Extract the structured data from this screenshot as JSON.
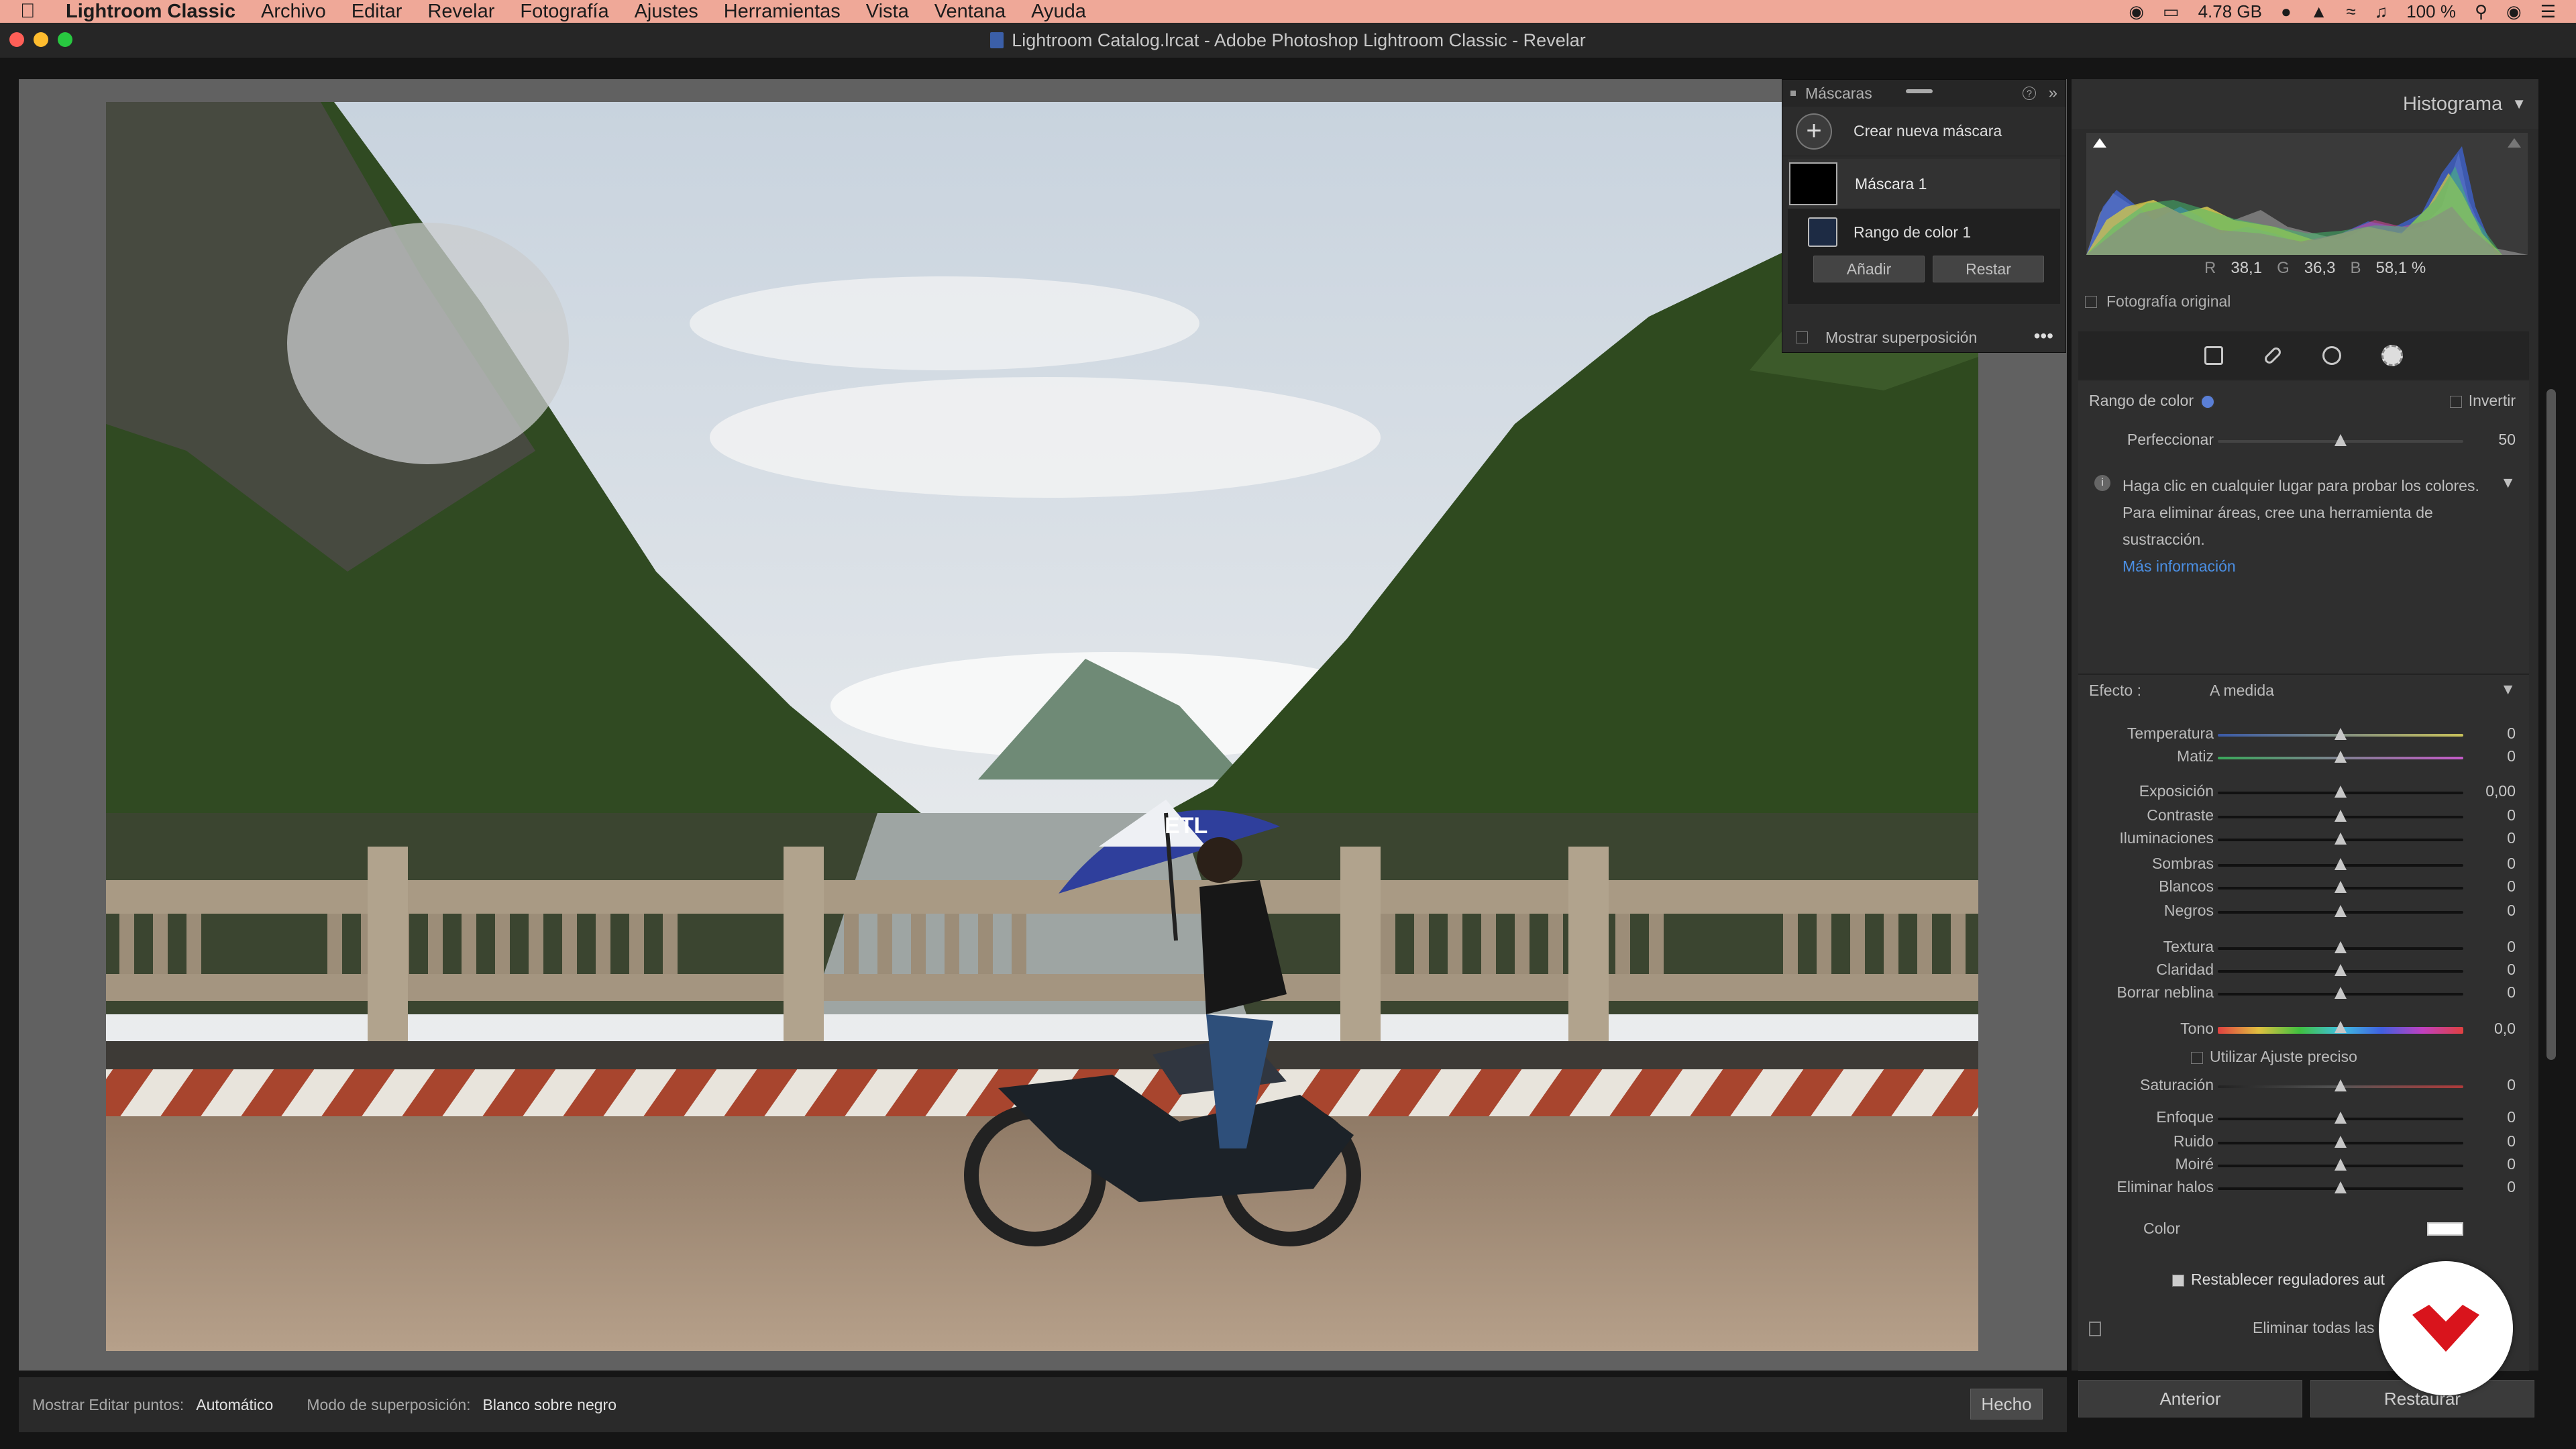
{
  "menubar": {
    "app_name": "Lightroom Classic",
    "items": [
      "Archivo",
      "Editar",
      "Revelar",
      "Fotografía",
      "Ajustes",
      "Herramientas",
      "Vista",
      "Ventana",
      "Ayuda"
    ],
    "memory": "4.78 GB",
    "battery": "100 %"
  },
  "window": {
    "title": "Lightroom Catalog.lrcat - Adobe Photoshop Lightroom Classic - Revelar"
  },
  "masks_panel": {
    "title": "Máscaras",
    "create_label": "Crear nueva máscara",
    "mask1_label": "Máscara 1",
    "component_label": "Rango de color 1",
    "add_label": "Añadir",
    "subtract_label": "Restar",
    "overlay_label": "Mostrar superposición"
  },
  "photo": {
    "umbrella_text": "ETL"
  },
  "bottom_toolbar": {
    "show_points_label": "Mostrar Editar puntos:",
    "show_points_value": "Automático",
    "overlay_mode_label": "Modo de superposición:",
    "overlay_mode_value": "Blanco sobre negro",
    "done_label": "Hecho"
  },
  "histogram": {
    "title": "Histograma",
    "r_label": "R",
    "r_value": "38,1",
    "g_label": "G",
    "g_value": "36,3",
    "b_label": "B",
    "b_value": "58,1 %",
    "original_label": "Fotografía original"
  },
  "mask_settings": {
    "color_range_label": "Rango de color",
    "invert_label": "Invertir",
    "refine_label": "Perfeccionar",
    "refine_value": "50",
    "refine_level": 0.5,
    "info_line1": "Haga clic en cualquier lugar para probar los colores.",
    "info_line2": "Para eliminar áreas, cree una herramienta de",
    "info_line3": "sustracción.",
    "more_info": "Más información"
  },
  "effect": {
    "label": "Efecto :",
    "preset": "A medida",
    "sliders": [
      {
        "label": "Temperatura",
        "value": "0"
      },
      {
        "label": "Matiz",
        "value": "0"
      },
      {
        "label": "Exposición",
        "value": "0,00"
      },
      {
        "label": "Contraste",
        "value": "0"
      },
      {
        "label": "Iluminaciones",
        "value": "0"
      },
      {
        "label": "Sombras",
        "value": "0"
      },
      {
        "label": "Blancos",
        "value": "0"
      },
      {
        "label": "Negros",
        "value": "0"
      },
      {
        "label": "Textura",
        "value": "0"
      },
      {
        "label": "Claridad",
        "value": "0"
      },
      {
        "label": "Borrar neblina",
        "value": "0"
      },
      {
        "label": "Tono",
        "value": "0,0"
      },
      {
        "label": "Saturación",
        "value": "0"
      },
      {
        "label": "Enfoque",
        "value": "0"
      },
      {
        "label": "Ruido",
        "value": "0"
      },
      {
        "label": "Moiré",
        "value": "0"
      },
      {
        "label": "Eliminar halos",
        "value": "0"
      }
    ],
    "precise_label": "Utilizar Ajuste preciso",
    "color_label": "Color",
    "reset_label": "Restablecer reguladores aut",
    "delete_all_label": "Eliminar todas las"
  },
  "footer_buttons": {
    "previous": "Anterior",
    "reset": "Restaurar"
  },
  "colors": {
    "menubar_bg": "#efa898",
    "link": "#4b8fe3",
    "logo_red": "#d9141c"
  }
}
